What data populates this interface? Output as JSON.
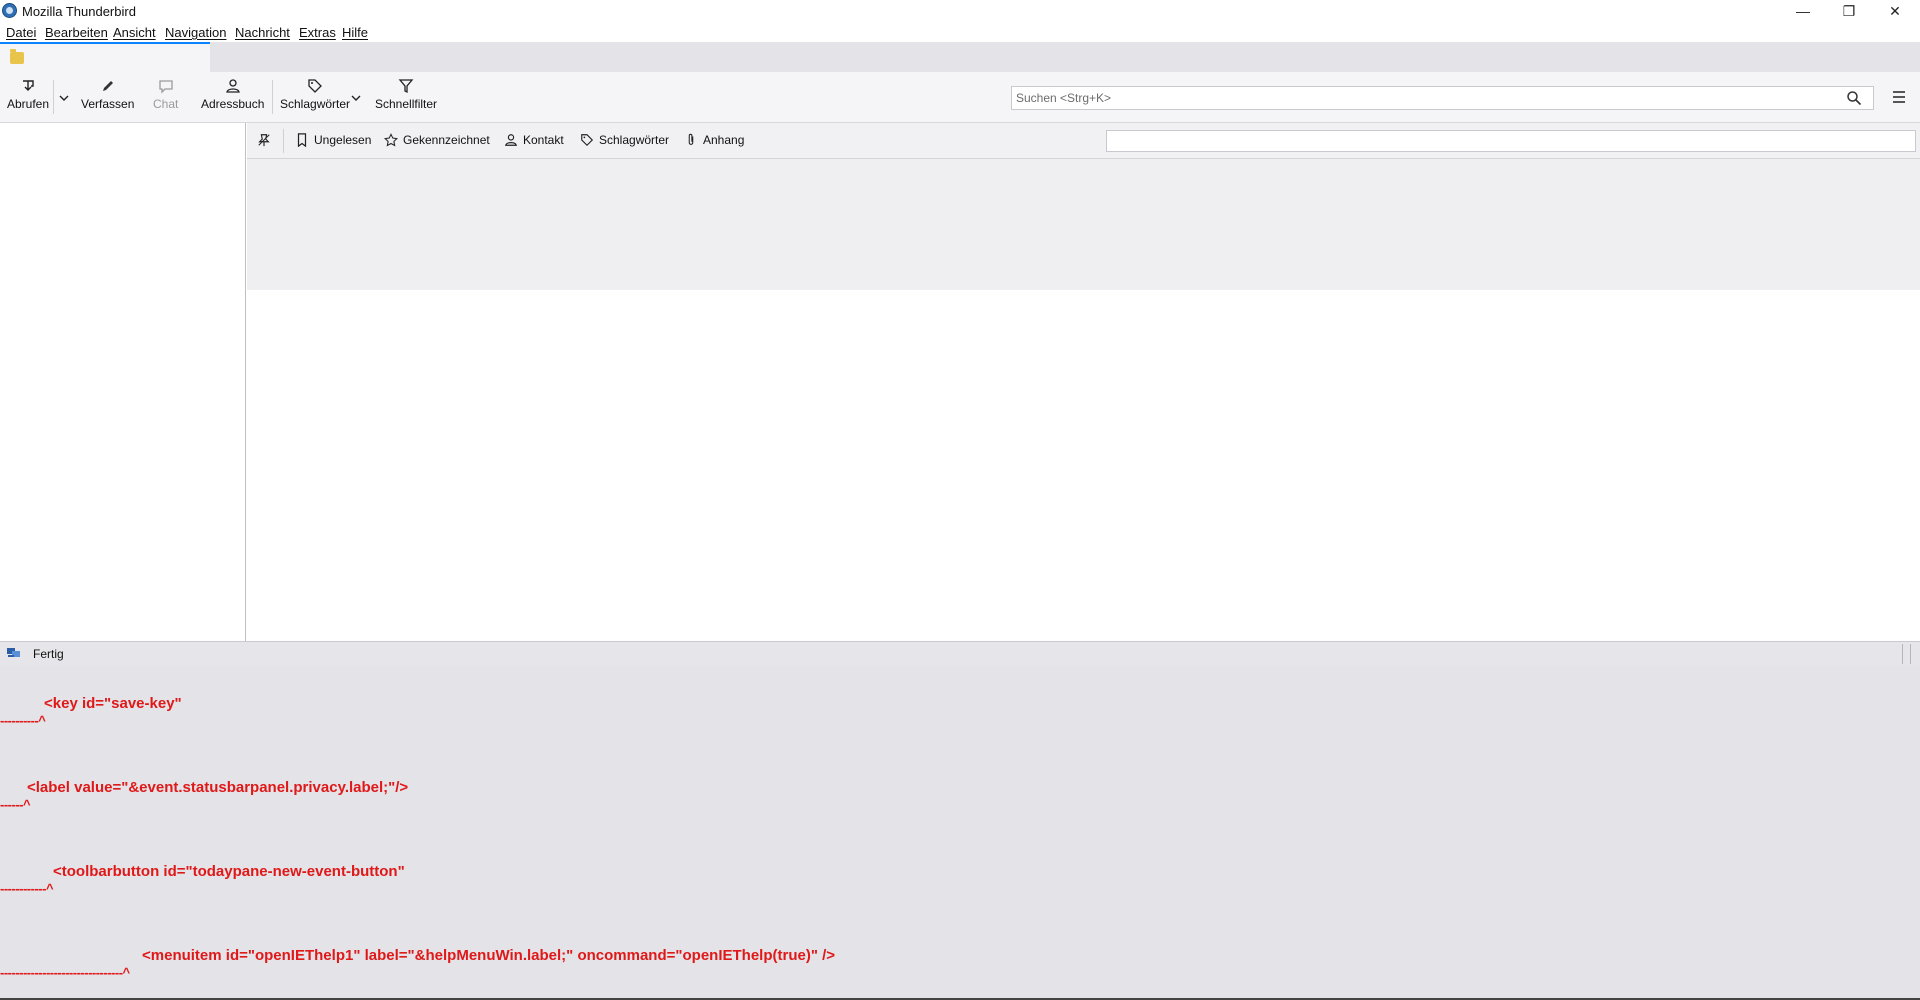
{
  "window": {
    "title": "Mozilla Thunderbird",
    "controls": [
      "minimize",
      "restore",
      "close"
    ]
  },
  "menubar": {
    "items": [
      "Datei",
      "Bearbeiten",
      "Ansicht",
      "Navigation",
      "Nachricht",
      "Extras",
      "Hilfe"
    ]
  },
  "toolbar": {
    "get_messages": "Abrufen",
    "compose": "Verfassen",
    "chat": "Chat",
    "address_book": "Adressbuch",
    "tags": "Schlagwörter",
    "quick_filter": "Schnellfilter"
  },
  "search": {
    "placeholder": "Suchen <Strg+K>"
  },
  "quick_filter_bar": {
    "unread": "Ungelesen",
    "starred": "Gekennzeichnet",
    "contact": "Kontakt",
    "tags": "Schlagwörter",
    "attachment": "Anhang"
  },
  "statusbar": {
    "text": "Fertig"
  },
  "errors": [
    {
      "line": "<key id=\"save-key\"",
      "caret": "----------^"
    },
    {
      "line": "<label value=\"&event.statusbarpanel.privacy.label;\"/>",
      "caret": "------^"
    },
    {
      "line": "<toolbarbutton id=\"todaypane-new-event-button\"",
      "caret": "------------^"
    },
    {
      "line": "<menuitem id=\"openIEThelp1\" label=\"&helpMenuWin.label;\" oncommand=\"openIEThelp(true)\" />",
      "caret": "--------------------------------^"
    }
  ],
  "colors": {
    "error_text": "#e01818",
    "accent": "#0a84ff"
  }
}
